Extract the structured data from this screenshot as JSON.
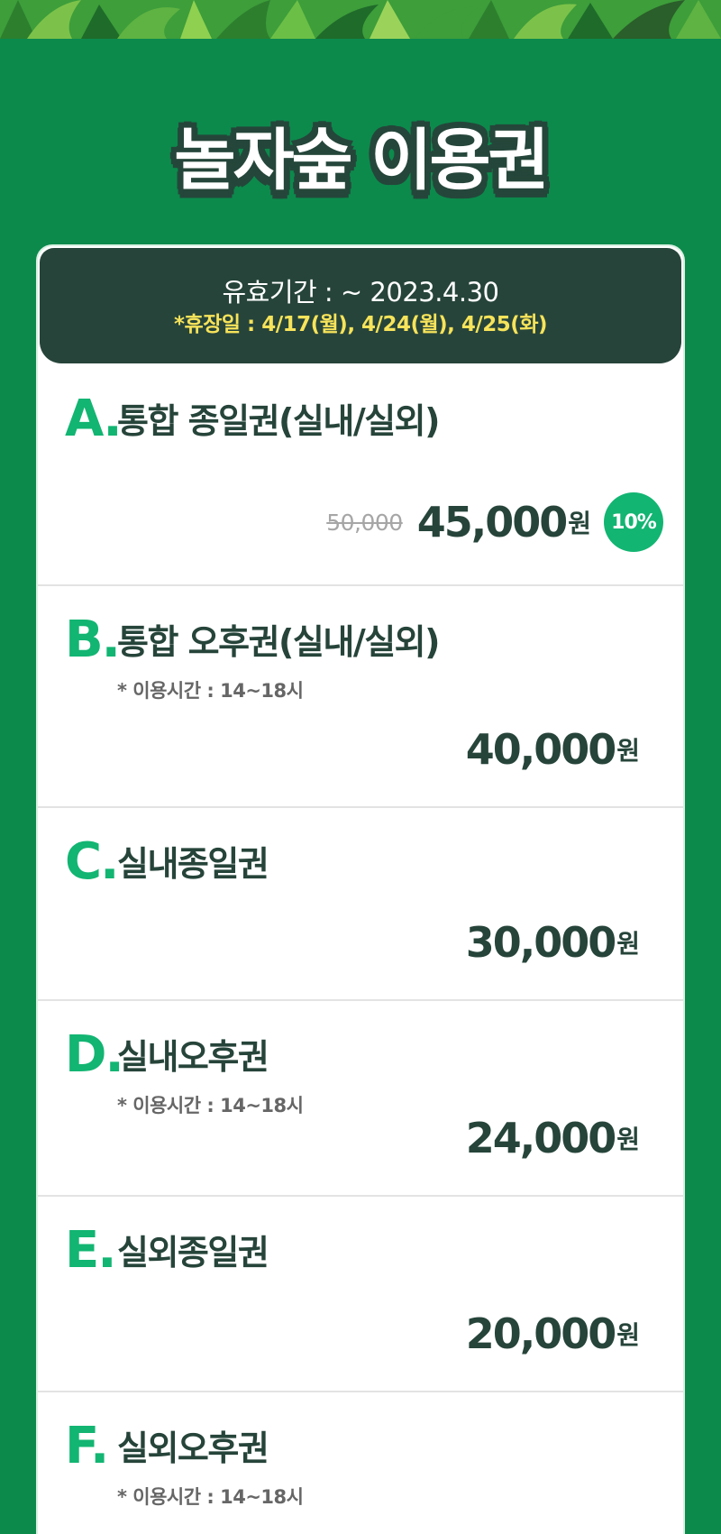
{
  "header": {
    "title": "놀자숲 이용권"
  },
  "validity": {
    "period": "유효기간 : ~ 2023.4.30",
    "holidays": "*휴장일 : 4/17(월), 4/24(월), 4/25(화)"
  },
  "tickets": [
    {
      "letter": "A.",
      "name": "통합 종일권(실내/실외)",
      "note": "",
      "original_price": "50,000",
      "price": "45,000",
      "currency": "원",
      "discount": "10%"
    },
    {
      "letter": "B.",
      "name": "통합 오후권(실내/실외)",
      "note": "* 이용시간 : 14~18시",
      "price": "40,000",
      "currency": "원"
    },
    {
      "letter": "C.",
      "name": "실내종일권",
      "note": "",
      "price": "30,000",
      "currency": "원"
    },
    {
      "letter": "D.",
      "name": "실내오후권",
      "note": "* 이용시간 : 14~18시",
      "price": "24,000",
      "currency": "원"
    },
    {
      "letter": "E.",
      "name": "실외종일권",
      "note": "",
      "price": "20,000",
      "currency": "원"
    },
    {
      "letter": "F.",
      "name": "실외오후권",
      "note": "* 이용시간 : 14~18시"
    }
  ],
  "colors": {
    "background": "#0c8a4c",
    "dark_green": "#26443a",
    "accent_green": "#12b572",
    "holiday_yellow": "#f7e35a"
  }
}
